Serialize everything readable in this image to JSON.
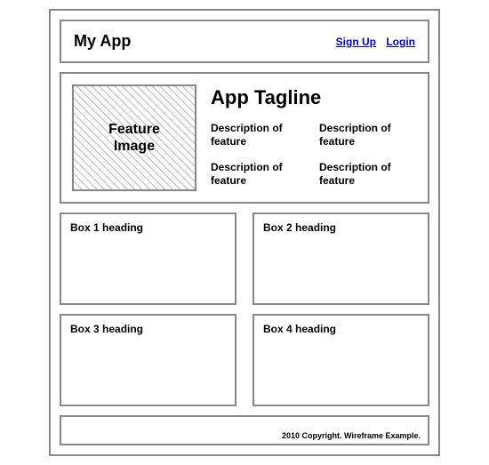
{
  "header": {
    "app_name": "My App",
    "signup_label": "Sign Up",
    "login_label": "Login"
  },
  "hero": {
    "feature_image_label": "Feature\nImage",
    "tagline": "App Tagline",
    "descriptions": [
      "Description of feature",
      "Description of feature",
      "Description of feature",
      "Description of feature"
    ]
  },
  "boxes": [
    {
      "heading": "Box 1 heading"
    },
    {
      "heading": "Box 2 heading"
    },
    {
      "heading": "Box 3 heading"
    },
    {
      "heading": "Box 4 heading"
    }
  ],
  "footer": {
    "text": "2010 Copyright. Wireframe Example."
  }
}
